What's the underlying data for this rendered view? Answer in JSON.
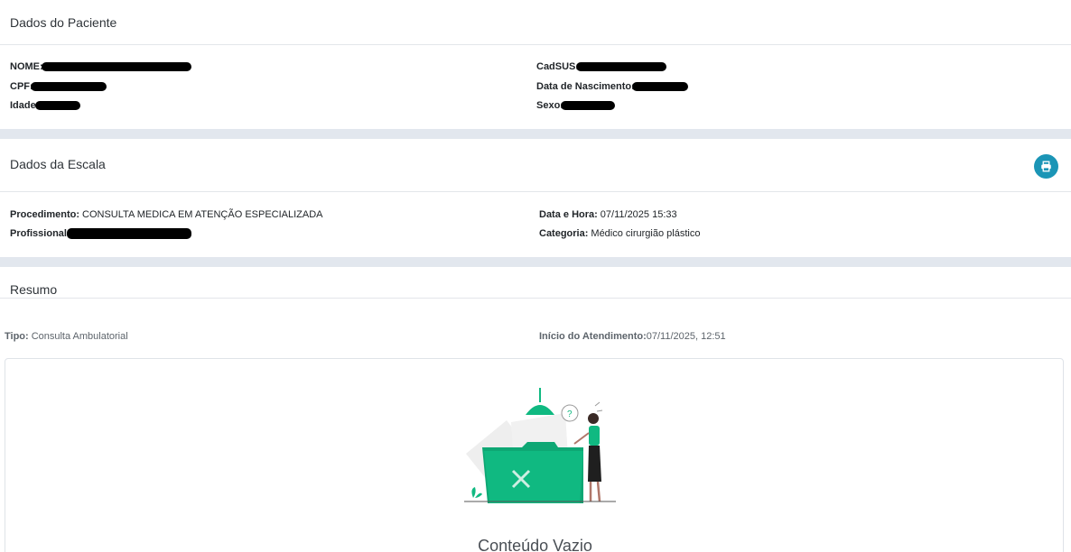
{
  "patient": {
    "title": "Dados do Paciente",
    "nome_label": "NOME:",
    "cpf_label": "CPF:",
    "idade_label": "Idade:",
    "cadsus_label": "CadSUS:",
    "nascimento_label": "Data de Nascimento:",
    "sexo_label": "Sexo:"
  },
  "escala": {
    "title": "Dados da Escala",
    "procedimento_label": "Procedimento:",
    "procedimento_value": "CONSULTA MEDICA EM ATENÇÃO ESPECIALIZADA",
    "profissional_label": "Profissional:",
    "datahora_label": "Data e Hora:",
    "datahora_value": "07/11/2025 15:33",
    "categoria_label": "Categoria:",
    "categoria_value": "Médico cirurgião plástico",
    "print_icon": "printer-icon"
  },
  "resumo": {
    "title": "Resumo",
    "tipo_label": "Tipo:",
    "tipo_value": "Consulta Ambulatorial",
    "inicio_label": "Início do Atendimento:",
    "inicio_value": "07/11/2025, 12:51",
    "empty_text": "Conteúdo Vazio",
    "empty_illustration": "empty-folder-illustration"
  },
  "colors": {
    "accent": "#1b95b6",
    "illustration_green": "#10b981",
    "background": "#e2e7ee"
  }
}
